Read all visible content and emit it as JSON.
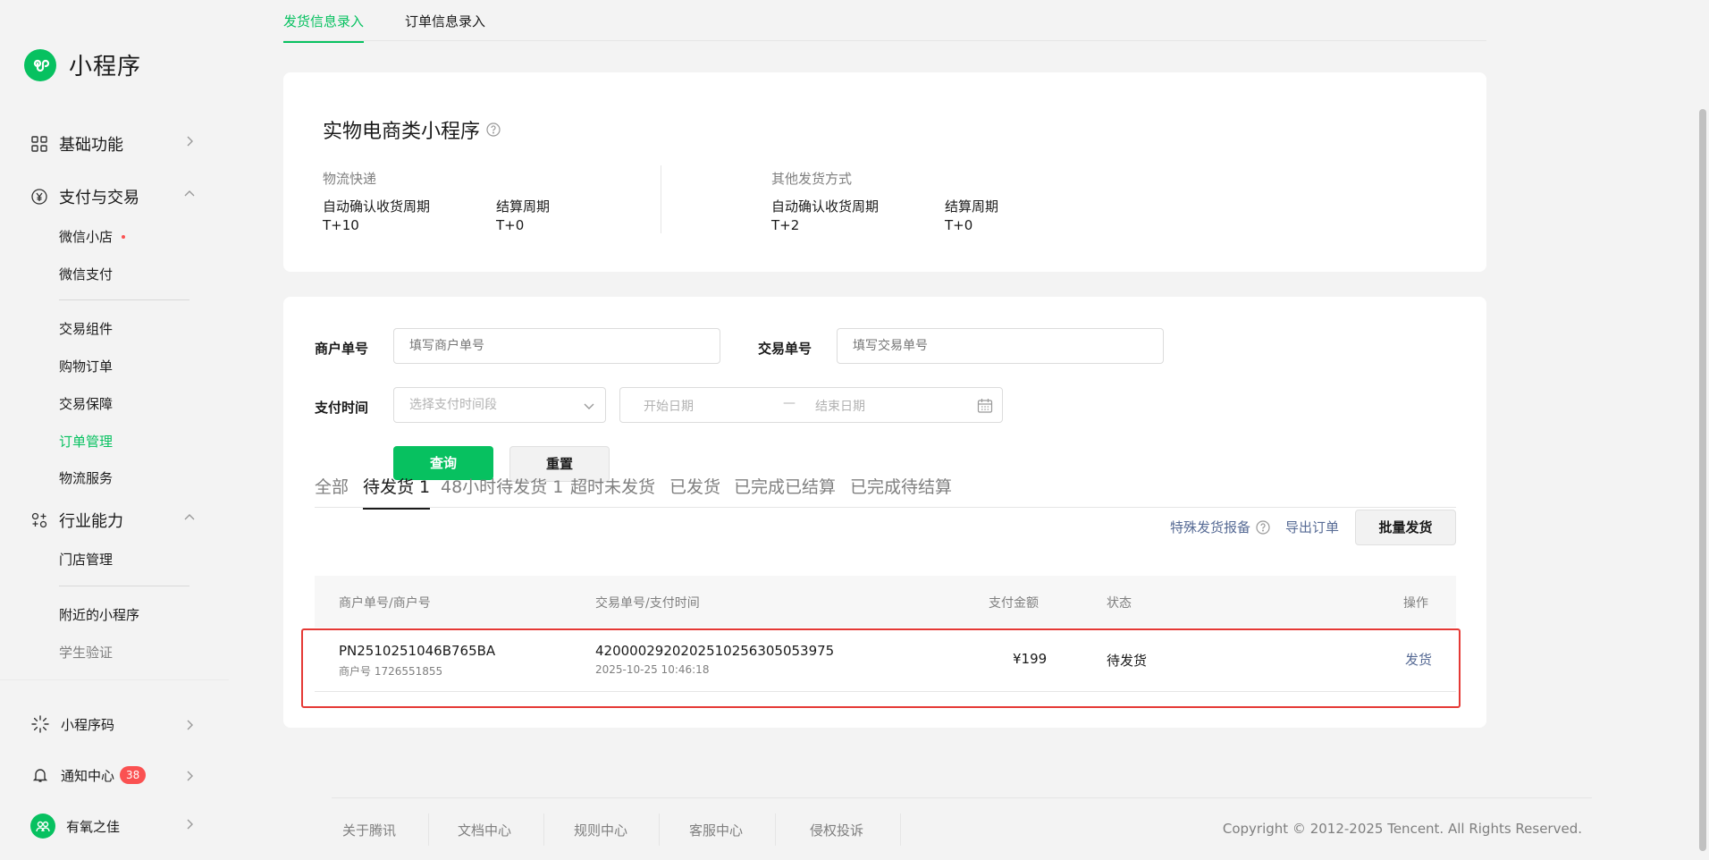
{
  "app": {
    "title": "小程序"
  },
  "sidebar": {
    "groups": [
      {
        "label": "基础功能",
        "icon": "grid-icon"
      },
      {
        "label": "支付与交易",
        "icon": "yen-circle-icon",
        "items": [
          {
            "label": "微信小店",
            "dot": true
          },
          {
            "label": "微信支付"
          },
          {
            "label": "交易组件"
          },
          {
            "label": "购物订单"
          },
          {
            "label": "交易保障"
          },
          {
            "label": "订单管理",
            "active": true
          },
          {
            "label": "物流服务"
          }
        ]
      },
      {
        "label": "行业能力",
        "icon": "industry-icon",
        "items": [
          {
            "label": "门店管理"
          },
          {
            "label": "附近的小程序"
          },
          {
            "label": "学生验证"
          }
        ]
      }
    ],
    "bottom": [
      {
        "label": "小程序码",
        "icon": "qrcode-sun-icon"
      },
      {
        "label": "通知中心",
        "icon": "bell-icon",
        "badge": "38"
      },
      {
        "label": "有氧之佳",
        "icon": "avatar"
      }
    ]
  },
  "top_tabs": [
    {
      "label": "发货信息录入",
      "active": true
    },
    {
      "label": "订单信息录入",
      "active": false
    }
  ],
  "info_card": {
    "title": "实物电商类小程序",
    "blocks": [
      {
        "label": "物流快递",
        "fields": [
          {
            "key": "自动确认收货周期",
            "value": "T+10"
          },
          {
            "key": "结算周期",
            "value": "T+0"
          }
        ]
      },
      {
        "label": "其他发货方式",
        "fields": [
          {
            "key": "自动确认收货周期",
            "value": "T+2"
          },
          {
            "key": "结算周期",
            "value": "T+0"
          }
        ]
      }
    ]
  },
  "filters": {
    "merchant_label": "商户单号",
    "merchant_placeholder": "填写商户单号",
    "trade_label": "交易单号",
    "trade_placeholder": "填写交易单号",
    "paytime_label": "支付时间",
    "paytime_select_placeholder": "选择支付时间段",
    "start_date_placeholder": "开始日期",
    "range_separator": "—",
    "end_date_placeholder": "结束日期",
    "query_button": "查询",
    "reset_button": "重置"
  },
  "status_tabs": [
    {
      "label": "全部",
      "active": false
    },
    {
      "label": "待发货 1",
      "active": true
    },
    {
      "label": "48小时待发货 1",
      "active": false
    },
    {
      "label": "超时未发货",
      "active": false
    },
    {
      "label": "已发货",
      "active": false
    },
    {
      "label": "已完成已结算",
      "active": false
    },
    {
      "label": "已完成待结算",
      "active": false
    }
  ],
  "actions": {
    "special_report": "特殊发货报备",
    "export": "导出订单",
    "batch_ship": "批量发货"
  },
  "table": {
    "headers": [
      "商户单号/商户号",
      "交易单号/支付时间",
      "支付金额",
      "状态",
      "操作"
    ],
    "rows": [
      {
        "merchant_order": "PN2510251046B765BA",
        "merchant_id": "商户号 1726551855",
        "trade_no": "4200002920202510256305053975",
        "pay_time": "2025-10-25 10:46:18",
        "amount": "¥199",
        "status": "待发货",
        "action": "发货"
      }
    ]
  },
  "footer": {
    "links": [
      "关于腾讯",
      "文档中心",
      "规则中心",
      "客服中心",
      "侵权投诉"
    ],
    "copyright": "Copyright © 2012-2025 Tencent. All Rights Reserved."
  },
  "colors": {
    "brand": "#07c160",
    "link": "#576b95",
    "danger": "#fa5151",
    "highlight_border": "#e53935"
  }
}
